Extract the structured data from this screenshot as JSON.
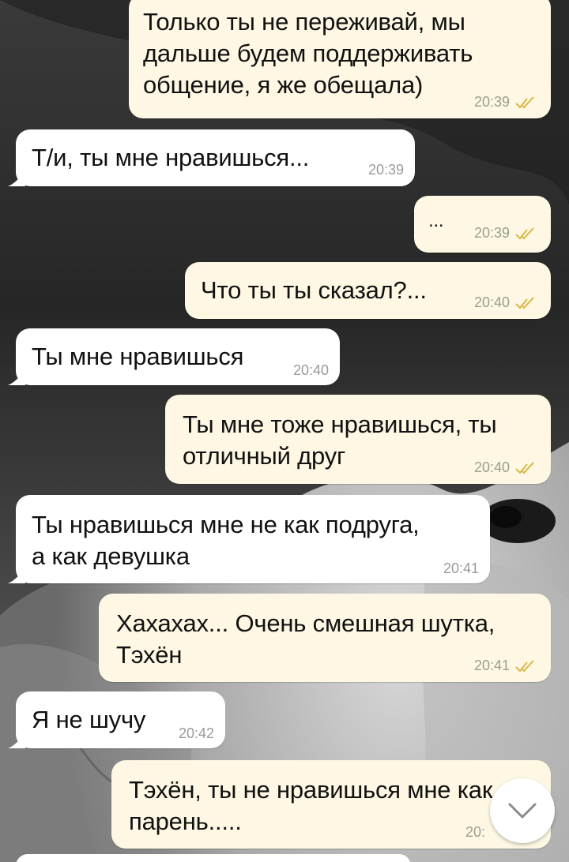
{
  "messages": [
    {
      "dir": "out",
      "text": "Только ты не переживай, мы\nдальше будем поддерживать\nобщение, я же обещала)",
      "time": "20:39",
      "read": true
    },
    {
      "dir": "in",
      "text": "Т/и, ты мне нравишься...",
      "time": "20:39"
    },
    {
      "dir": "out",
      "text": "...",
      "time": "20:39",
      "read": true
    },
    {
      "dir": "out",
      "text": "Что ты ты сказал?...",
      "time": "20:40",
      "read": true
    },
    {
      "dir": "in",
      "text": "Ты мне нравишься",
      "time": "20:40"
    },
    {
      "dir": "out",
      "text": "Ты мне тоже нравишься, ты\nотличный друг",
      "time": "20:40",
      "read": true
    },
    {
      "dir": "in",
      "text": "Ты нравишься мне не как подруга,\nа как девушка",
      "time": "20:41"
    },
    {
      "dir": "out",
      "text": "Хахахах... Очень смешная шутка,\nТэхён",
      "time": "20:41",
      "read": true
    },
    {
      "dir": "in",
      "text": "Я не шучу",
      "time": "20:42"
    },
    {
      "dir": "out",
      "text": "Тэхён, ты не нравишься мне как\nпарень.....",
      "time": "20:",
      "read": true
    }
  ],
  "icons": {
    "read_receipt": "double-check-icon",
    "scroll_down": "chevron-down-icon"
  },
  "colors": {
    "incoming_bubble": "#ffffff",
    "outgoing_bubble": "#fdf7e3",
    "read_ticks": "#d8b84a",
    "time_text": "#9a9a9a"
  }
}
